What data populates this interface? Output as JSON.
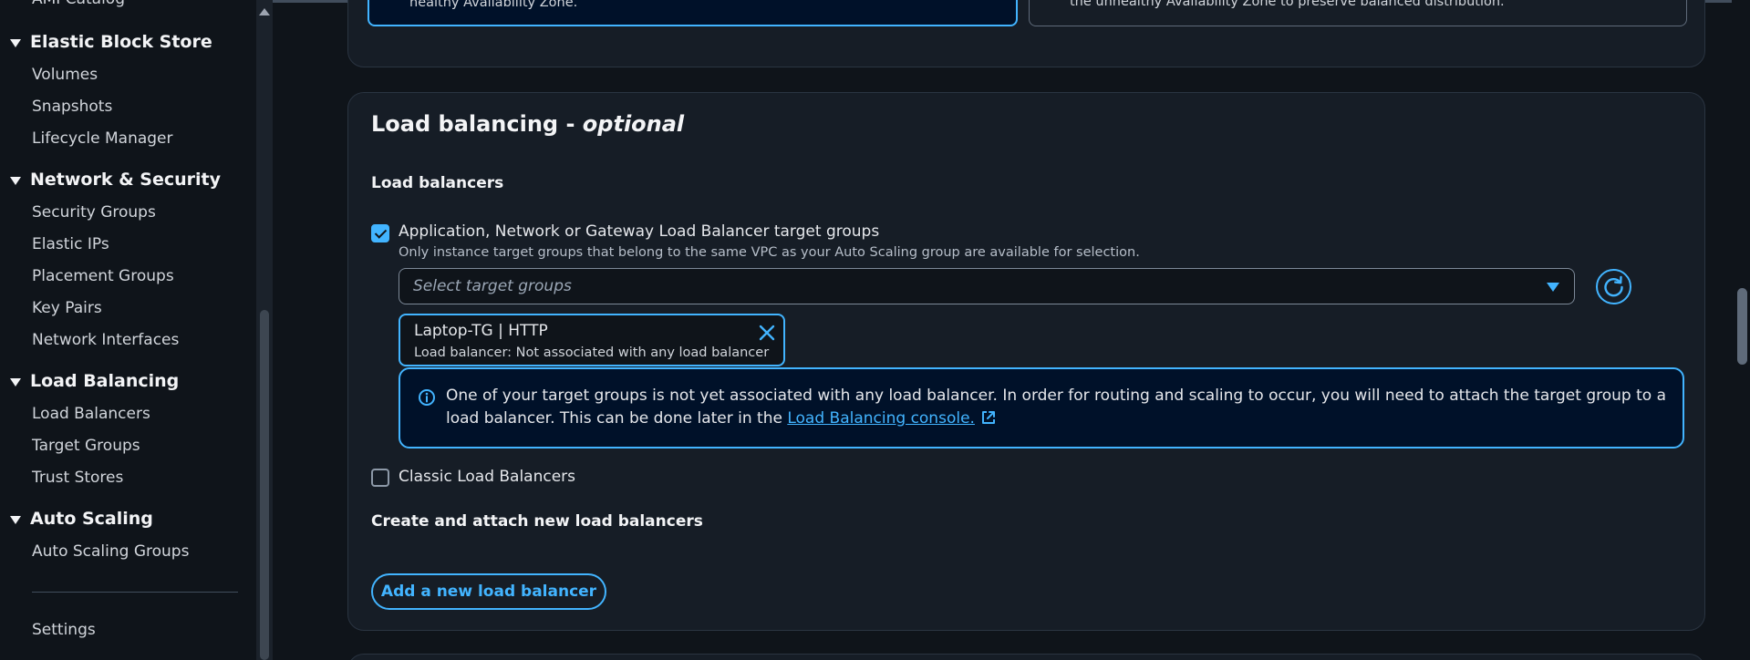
{
  "sidebar": {
    "cut_item": "AMI Catalog",
    "groups": [
      {
        "label": "Elastic Block Store",
        "items": [
          {
            "label": "Volumes"
          },
          {
            "label": "Snapshots"
          },
          {
            "label": "Lifecycle Manager"
          }
        ]
      },
      {
        "label": "Network & Security",
        "items": [
          {
            "label": "Security Groups"
          },
          {
            "label": "Elastic IPs"
          },
          {
            "label": "Placement Groups"
          },
          {
            "label": "Key Pairs"
          },
          {
            "label": "Network Interfaces"
          }
        ]
      },
      {
        "label": "Load Balancing",
        "items": [
          {
            "label": "Load Balancers"
          },
          {
            "label": "Target Groups"
          },
          {
            "label": "Trust Stores"
          }
        ]
      },
      {
        "label": "Auto Scaling",
        "items": [
          {
            "label": "Auto Scaling Groups"
          }
        ]
      }
    ],
    "settings_label": "Settings"
  },
  "az_rebalance": {
    "tile_selected": "If launches fail in one Availability Zone, Auto Scaling will attempt to launch in another healthy Availability Zone.",
    "tile_unselected": "If launches fail in one Availability Zone, Auto Scaling will continue to attempt to launch in the unhealthy Availability Zone to preserve balanced distribution."
  },
  "load_balancing": {
    "title": "Load balancing - ",
    "title_optional": "optional",
    "load_balancers_label": "Load balancers",
    "option_target_groups": {
      "label": "Application, Network or Gateway Load Balancer target groups",
      "checked": true,
      "description": "Only instance target groups that belong to the same VPC as your Auto Scaling group are available for selection."
    },
    "select_placeholder": "Select target groups",
    "selected_token": {
      "name": "Laptop-TG | HTTP",
      "detail": "Load balancer: Not associated with any load balancer"
    },
    "alert": {
      "text": "One of your target groups is not yet associated with any load balancer. In order for routing and scaling to occur, you will need to attach the target group to a load balancer. This can be done later in the ",
      "link_text": "Load Balancing console."
    },
    "option_classic": {
      "label": "Classic Load Balancers",
      "checked": false
    },
    "create_attach_label": "Create and attach new load balancers",
    "add_button": "Add a new load balancer"
  },
  "colors": {
    "accent": "#42b4ff",
    "background": "#0f141a",
    "panel": "#161d26"
  }
}
